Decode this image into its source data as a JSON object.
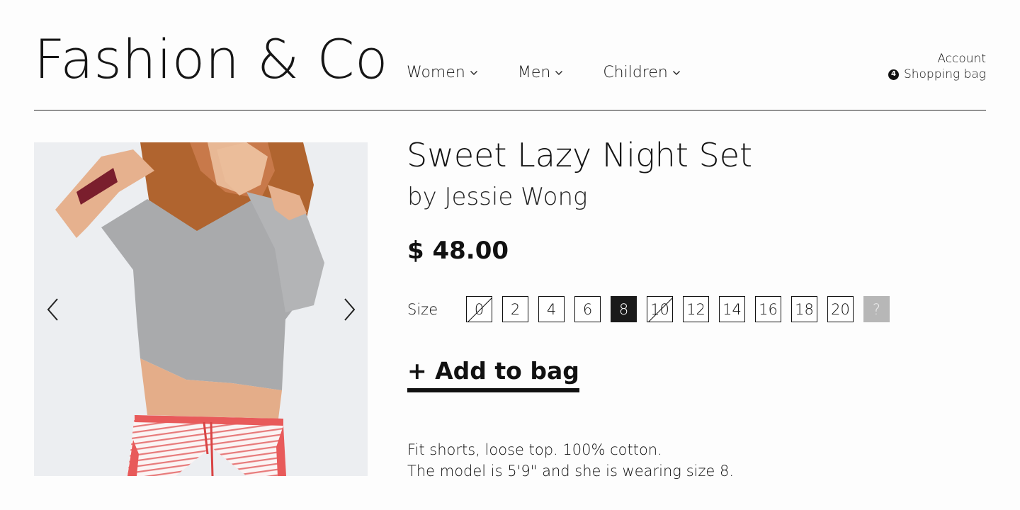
{
  "brand": {
    "logo": "Fashion & Co"
  },
  "nav": {
    "items": [
      {
        "label": "Women",
        "icon": "chevron-down-icon"
      },
      {
        "label": "Men",
        "icon": "chevron-down-icon"
      },
      {
        "label": "Children",
        "icon": "chevron-down-icon"
      }
    ]
  },
  "account": {
    "account_label": "Account",
    "bag_label": "Shopping bag",
    "bag_count": "4"
  },
  "product": {
    "title": "Sweet Lazy Night Set",
    "designer": "by Jessie Wong",
    "price": "$ 48.00",
    "size_label": "Size",
    "sizes": [
      {
        "label": "0",
        "state": "unavailable"
      },
      {
        "label": "2",
        "state": "available"
      },
      {
        "label": "4",
        "state": "available"
      },
      {
        "label": "6",
        "state": "available"
      },
      {
        "label": "8",
        "state": "selected"
      },
      {
        "label": "10",
        "state": "unavailable"
      },
      {
        "label": "12",
        "state": "available"
      },
      {
        "label": "14",
        "state": "available"
      },
      {
        "label": "16",
        "state": "available"
      },
      {
        "label": "18",
        "state": "available"
      },
      {
        "label": "20",
        "state": "available"
      },
      {
        "label": "?",
        "state": "help"
      }
    ],
    "add_to_bag_label": "+ Add to bag",
    "description": [
      "Fit shorts, loose top. 100% cotton.",
      "The model is 5'9\" and she is wearing size 8."
    ]
  },
  "gallery": {
    "prev_icon": "chevron-left-icon",
    "next_icon": "chevron-right-icon"
  },
  "colors": {
    "text": "#111111",
    "selected_bg": "#1a1a1a",
    "help_bg": "#b7b7b7",
    "shorts_red": "#e85a5a",
    "top_gray": "#a9aaac"
  }
}
